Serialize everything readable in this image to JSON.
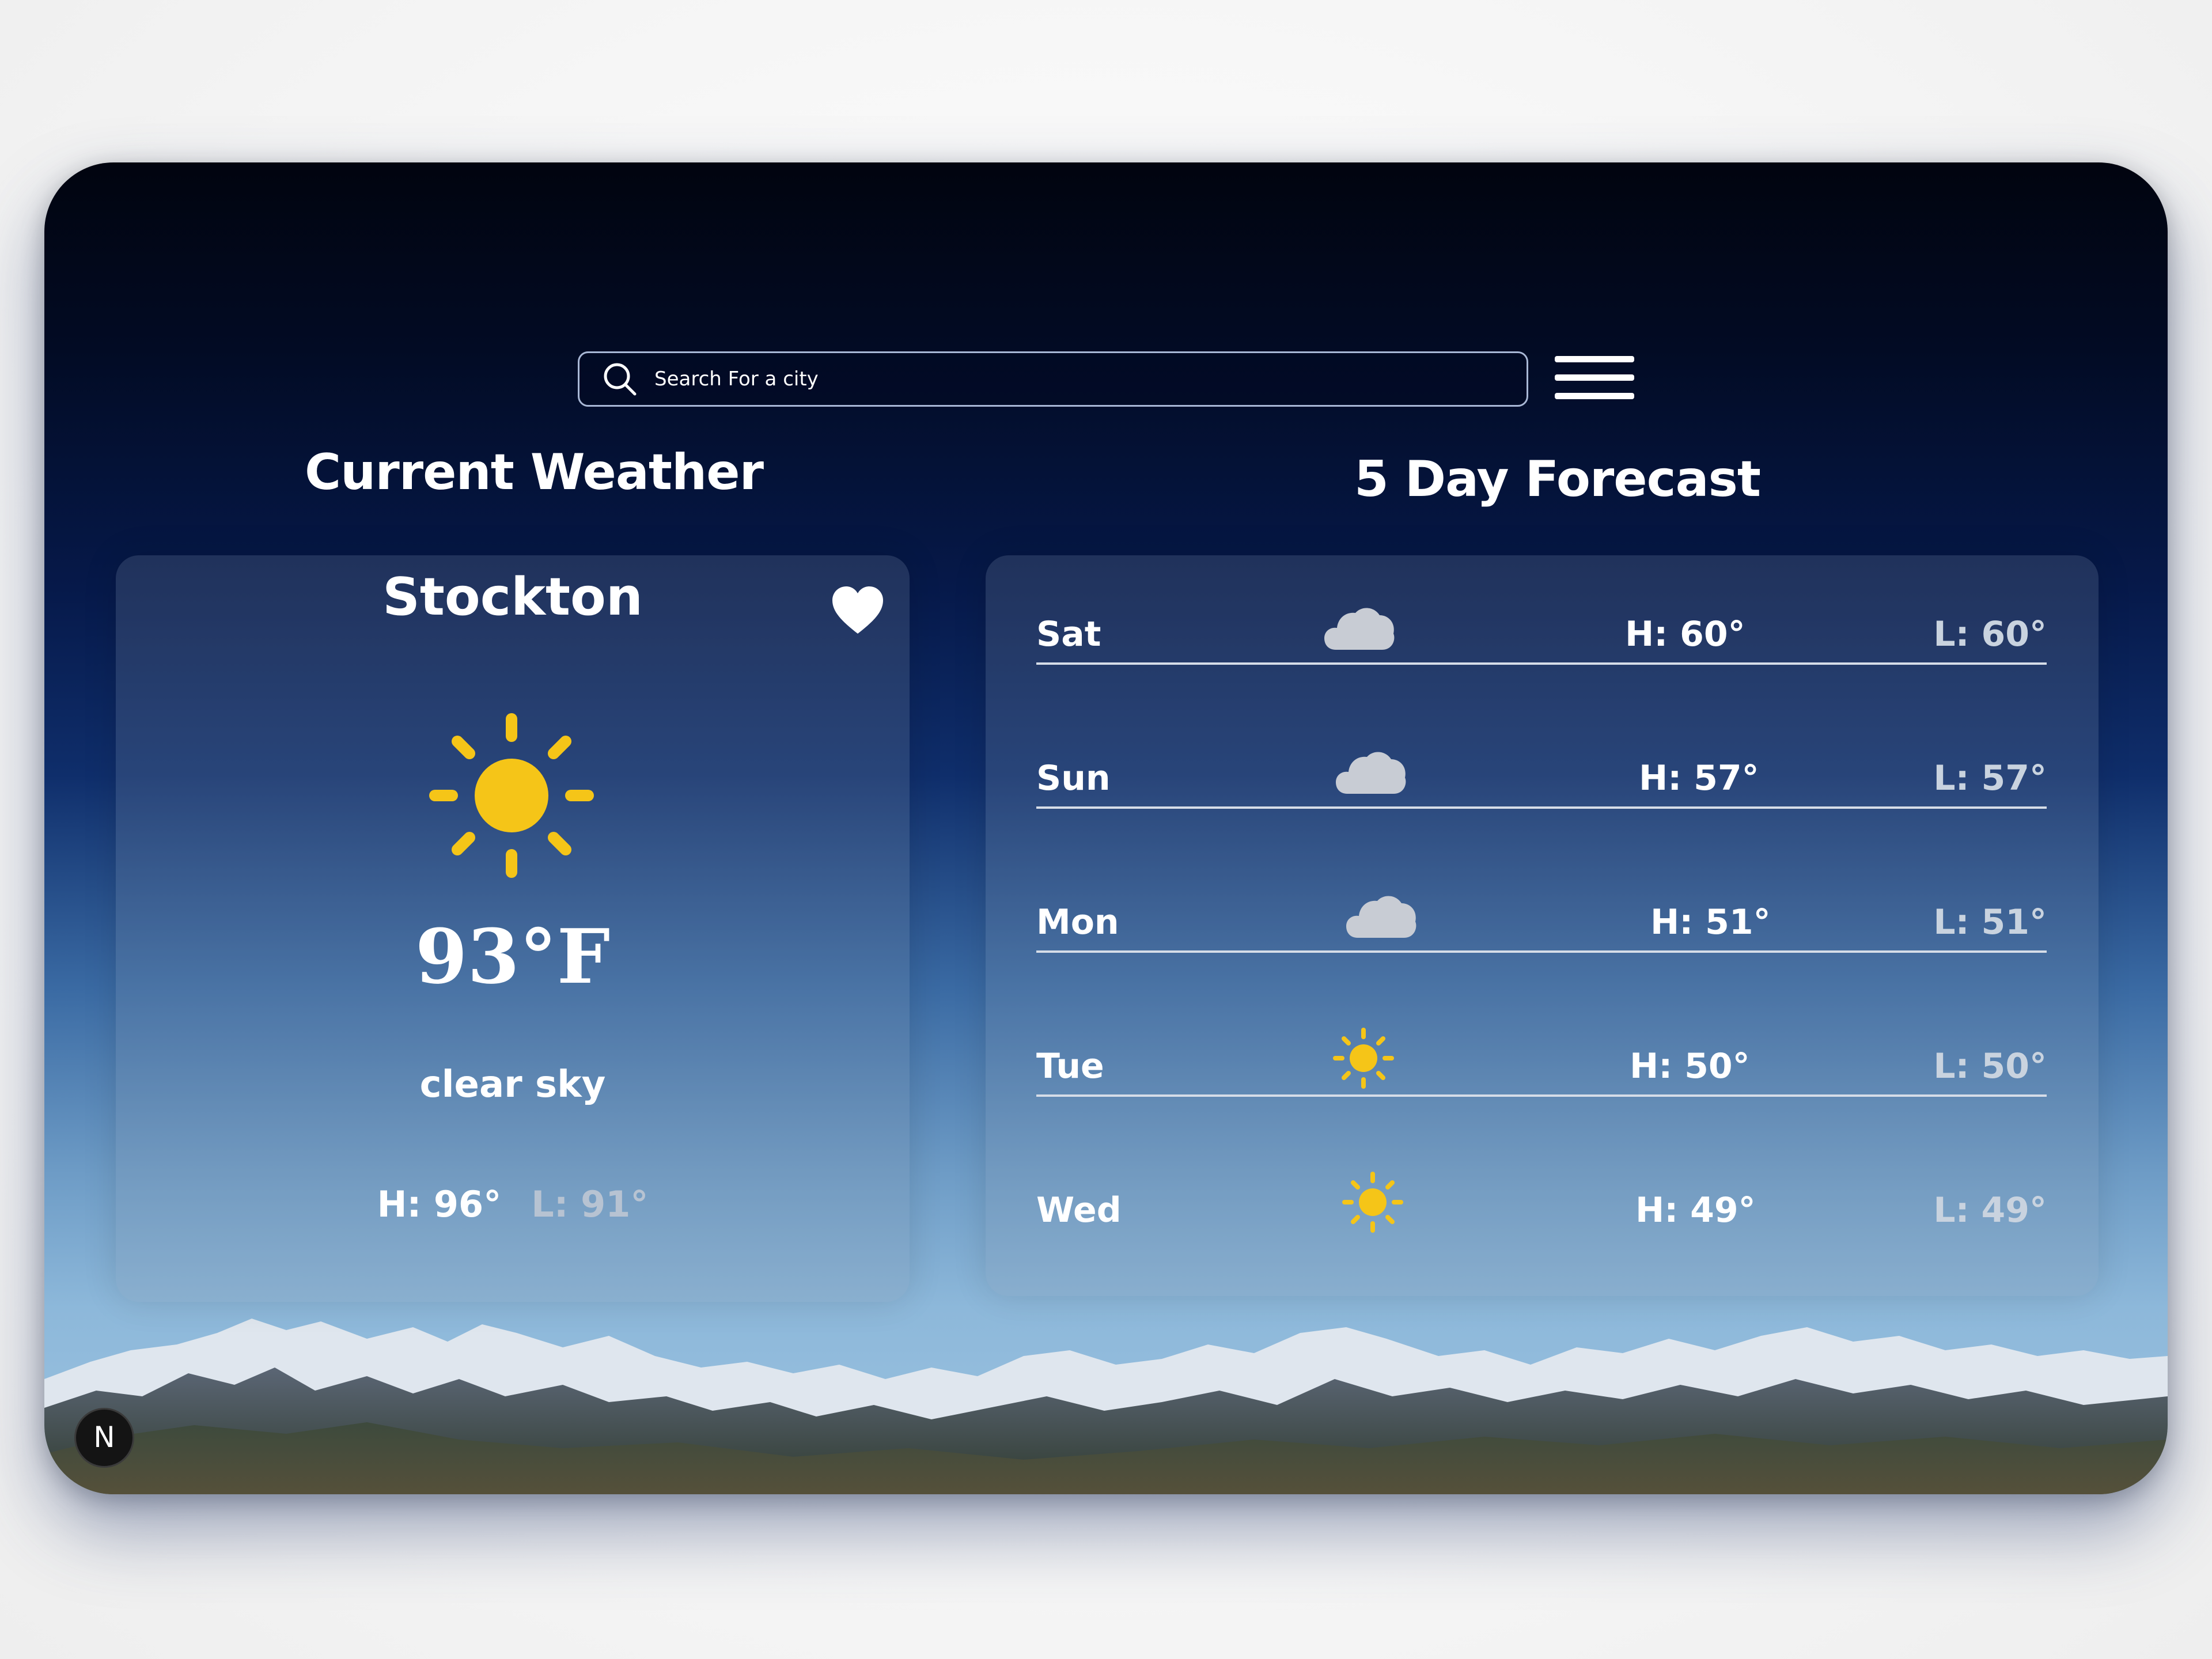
{
  "search": {
    "placeholder": "Search For a city",
    "icon": "search-icon"
  },
  "menu": {
    "icon": "hamburger-menu-icon"
  },
  "current": {
    "section_title": "Current Weather",
    "city": "Stockton",
    "favorite_icon": "heart-icon",
    "condition_icon": "sun-icon",
    "temperature": "93°F",
    "description": "clear sky",
    "high": "H: 96°",
    "low": "L: 91°"
  },
  "forecast": {
    "section_title": "5 Day Forecast",
    "days": [
      {
        "day": "Sat",
        "icon": "cloud-icon",
        "high": "H: 60°",
        "low": "L: 60°"
      },
      {
        "day": "Sun",
        "icon": "cloud-icon",
        "high": "H: 57°",
        "low": "L: 57°"
      },
      {
        "day": "Mon",
        "icon": "cloud-icon",
        "high": "H: 51°",
        "low": "L: 51°"
      },
      {
        "day": "Tue",
        "icon": "sun-icon",
        "high": "H: 50°",
        "low": "L: 50°"
      },
      {
        "day": "Wed",
        "icon": "sun-icon",
        "high": "H: 49°",
        "low": "L: 49°"
      }
    ]
  },
  "badge": {
    "label": "N"
  },
  "colors": {
    "sun": "#f5c518",
    "cloud": "#c8ccd4",
    "text": "#ffffff",
    "low_text": "#c9d3df"
  }
}
